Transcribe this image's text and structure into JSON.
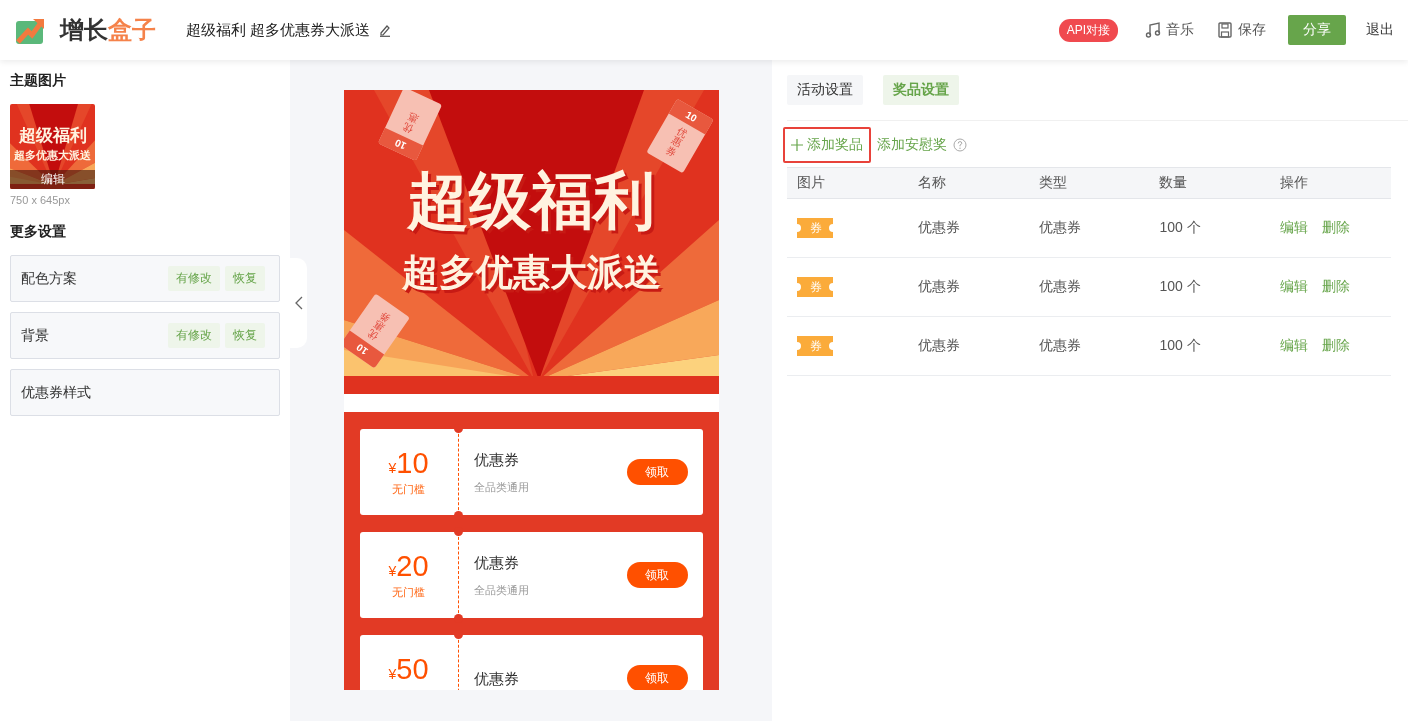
{
  "header": {
    "logo": {
      "text_dark": "增长",
      "text_accent": "盒子"
    },
    "title": "超级福利 超多优惠券大派送",
    "api_badge": "API对接",
    "actions": [
      {
        "kind": "music",
        "label": "音乐"
      },
      {
        "kind": "save",
        "label": "保存"
      },
      {
        "kind": "primary",
        "label": "分享"
      },
      {
        "kind": "plain",
        "label": "退出"
      }
    ]
  },
  "left_panel": {
    "theme_heading": "主题图片",
    "thumbnail": {
      "title": "超级福利",
      "subtitle": "超多优惠大派送",
      "edit_label": "编辑"
    },
    "size_note": "750 x 645px",
    "more_heading": "更多设置",
    "settings": [
      {
        "label": "配色方案",
        "tags": [
          "有修改",
          "恢复"
        ]
      },
      {
        "label": "背景",
        "tags": [
          "有修改",
          "恢复"
        ]
      },
      {
        "label": "优惠券样式"
      }
    ]
  },
  "preview": {
    "banner": {
      "title": "超级福利",
      "subtitle": "超多优惠大派送",
      "tickets": [
        {
          "value": "10",
          "label": "优惠"
        },
        {
          "value": "10",
          "label": "优惠券"
        },
        {
          "value": "10",
          "label": "优惠券"
        }
      ]
    },
    "coupons": [
      {
        "currency": "¥",
        "amount": "10",
        "condition": "无门槛",
        "name": "优惠券",
        "scope": "全品类通用",
        "button": "领取"
      },
      {
        "currency": "¥",
        "amount": "20",
        "condition": "无门槛",
        "name": "优惠券",
        "scope": "全品类通用",
        "button": "领取"
      },
      {
        "currency": "¥",
        "amount": "50",
        "name": "优惠券",
        "button": "领取"
      }
    ]
  },
  "right_panel": {
    "tabs": [
      {
        "label": "活动设置",
        "selected": false
      },
      {
        "label": "奖品设置",
        "selected": true
      }
    ],
    "add_prize": {
      "label": "添加奖品",
      "highlighted": true
    },
    "add_consolation": "添加安慰奖",
    "table": {
      "columns": [
        "图片",
        "名称",
        "类型",
        "数量",
        "操作"
      ],
      "rows": [
        {
          "image_label": "券",
          "name": "优惠券",
          "type": "优惠券",
          "quantity": "100 个",
          "actions": [
            "编辑",
            "删除"
          ]
        },
        {
          "image_label": "券",
          "name": "优惠券",
          "type": "优惠券",
          "quantity": "100 个",
          "actions": [
            "编辑",
            "删除"
          ]
        },
        {
          "image_label": "券",
          "name": "优惠券",
          "type": "优惠券",
          "quantity": "100 个",
          "actions": [
            "编辑",
            "删除"
          ]
        }
      ]
    }
  }
}
